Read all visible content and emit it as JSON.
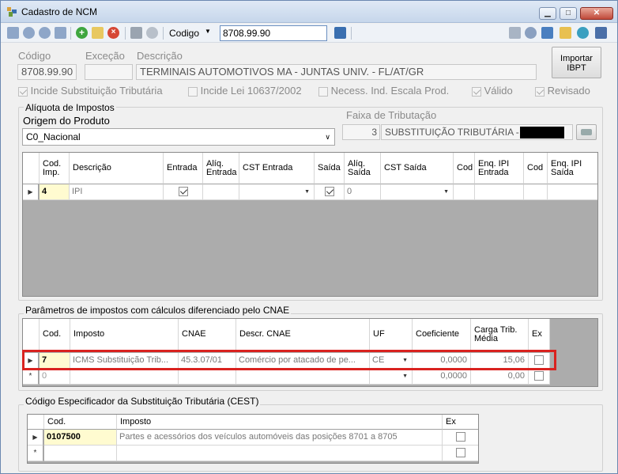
{
  "window": {
    "title": "Cadastro de NCM"
  },
  "toolbar": {
    "codigo_label": "Codigo",
    "codigo_value": "8708.99.90"
  },
  "form": {
    "codigo_label": "Código",
    "excecao_label": "Exceção",
    "descricao_label": "Descrição",
    "codigo_value": "8708.99.90",
    "excecao_value": "",
    "descricao_value": "TERMINAIS AUTOMOTIVOS MA - JUNTAS UNIV. - FL/AT/GR",
    "importar_label": "Importar IBPT",
    "checks": [
      {
        "label": "Incide Substituição Tributária",
        "checked": true
      },
      {
        "label": "Incide Lei 10637/2002",
        "checked": false
      },
      {
        "label": "Necess. Ind. Escala Prod.",
        "checked": false
      },
      {
        "label": "Válido",
        "checked": true
      },
      {
        "label": "Revisado",
        "checked": true
      }
    ]
  },
  "aliquota": {
    "group_label": "Alíquota de Impostos",
    "origem_label": "Origem do Produto",
    "origem_value": "C0_Nacional",
    "faixa_label": "Faixa de Tributação",
    "faixa_num": "3",
    "faixa_value": "SUBSTITUIÇÃO TRIBUTÁRIA -",
    "columns": [
      "Cod. Imp.",
      "Descrição",
      "Entrada",
      "Alíq. Entrada",
      "CST Entrada",
      "Saída",
      "Alíq. Saída",
      "CST Saída",
      "Cod",
      "Enq. IPI Entrada",
      "Cod",
      "Enq. IPI Saída"
    ],
    "rows": [
      {
        "cod": "4",
        "descricao": "IPI",
        "entrada": true,
        "aliq_entrada": "",
        "cst_entrada": "",
        "saida": true,
        "aliq_saida": "0",
        "cst_saida": "",
        "cod1": "",
        "enq_entrada": "",
        "cod2": "",
        "enq_saida": ""
      }
    ]
  },
  "cnae": {
    "group_label": "Parâmetros de impostos com cálculos diferenciado pelo CNAE",
    "columns": [
      "Cod.",
      "Imposto",
      "CNAE",
      "Descr. CNAE",
      "UF",
      "Coeficiente",
      "Carga Trib. Média",
      "Ex"
    ],
    "rows": [
      {
        "cod": "7",
        "imposto": "ICMS Substituição Trib...",
        "cnae": "45.3.07/01",
        "descr": "Comércio por atacado de pe...",
        "uf": "CE",
        "coef": "0,0000",
        "carga": "15,06",
        "ex": false
      },
      {
        "cod": "0",
        "imposto": "",
        "cnae": "",
        "descr": "",
        "uf": "",
        "coef": "0,0000",
        "carga": "0,00",
        "ex": false
      }
    ],
    "highlight_color": "#d9221f"
  },
  "cest": {
    "group_label": "Código Especificador da Substituição Tributária (CEST)",
    "columns": [
      "Cod.",
      "Imposto",
      "Ex"
    ],
    "rows": [
      {
        "cod": "0107500",
        "imposto": "Partes e acessórios dos veículos automóveis das posições 8701 a 8705",
        "ex": false
      },
      {
        "cod": "",
        "imposto": "",
        "ex": false
      }
    ]
  },
  "colors": {
    "cell_highlight": "#fffbd0",
    "grid_bg": "#acacac"
  }
}
